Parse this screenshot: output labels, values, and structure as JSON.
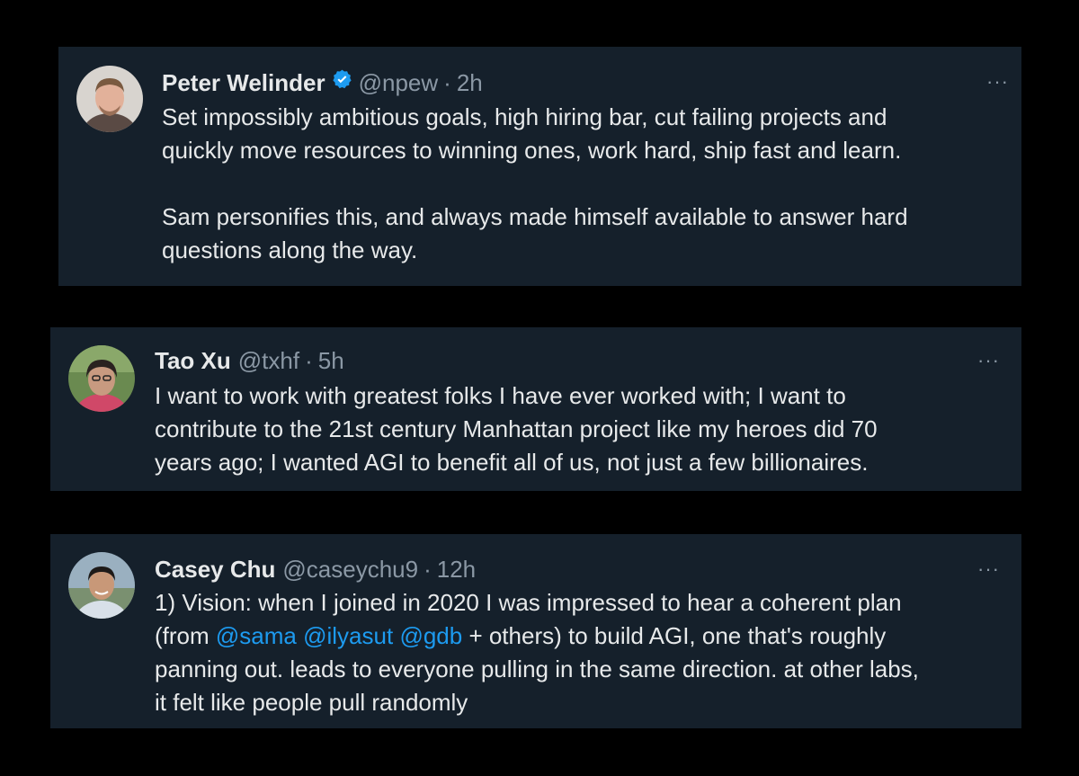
{
  "tweets": [
    {
      "name": "Peter Welinder",
      "verified": true,
      "handle": "@npew",
      "separator": "·",
      "time": "2h",
      "more_label": "···",
      "lines": [
        "Set impossibly ambitious goals, high hiring bar, cut failing projects and",
        "quickly move resources to winning ones, work hard, ship fast and learn.",
        "",
        "Sam personifies this, and always made himself available to answer hard",
        "questions along the way."
      ]
    },
    {
      "name": "Tao Xu",
      "verified": false,
      "handle": "@txhf",
      "separator": "·",
      "time": "5h",
      "more_label": "···",
      "lines": [
        "I want to work with greatest folks I have ever worked with; I want to",
        "contribute to the 21st century Manhattan project like my heroes did 70",
        "years ago; I wanted AGI to benefit all of us, not just a few billionaires."
      ]
    },
    {
      "name": "Casey Chu",
      "verified": false,
      "handle": "@caseychu9",
      "separator": "·",
      "time": "12h",
      "more_label": "···",
      "lines": [
        "1) Vision: when I joined in 2020 I was impressed to hear a coherent plan",
        "",
        "panning out. leads to everyone pulling in the same direction. at other labs,",
        "it felt like people pull randomly"
      ],
      "line2": {
        "prefix": "(from ",
        "mention1": "@sama",
        "space1": " ",
        "mention2": "@ilyasut",
        "space2": " ",
        "mention3": "@gdb",
        "suffix": " + others) to build AGI, one that's roughly"
      }
    }
  ],
  "colors": {
    "background": "#000000",
    "card": "#15202b",
    "text": "#e7e9ea",
    "muted": "#8b98a5",
    "link": "#1d9bf0",
    "verified": "#1d9bf0"
  }
}
